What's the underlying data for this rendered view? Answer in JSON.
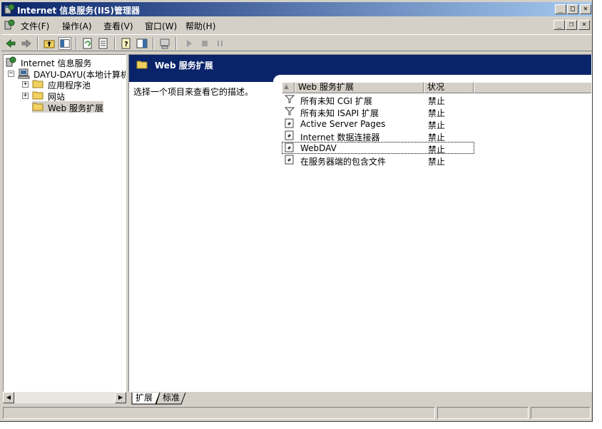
{
  "window": {
    "title": "Internet 信息服务(IIS)管理器",
    "minimize": "_",
    "maximize": "□",
    "close": "×"
  },
  "menubar": {
    "items": [
      {
        "label": "文件(F)"
      },
      {
        "label": "操作(A)"
      },
      {
        "label": "查看(V)"
      },
      {
        "label": "窗口(W)"
      },
      {
        "label": "帮助(H)"
      }
    ],
    "mdi_minimize": "_",
    "mdi_restore": "❐",
    "mdi_close": "×"
  },
  "tree": {
    "root": "Internet 信息服务",
    "computer": "DAYU-DAYU(本地计算机)",
    "expand_collapsed": "+",
    "expand_open": "−",
    "children": [
      {
        "label": "应用程序池"
      },
      {
        "label": "网站"
      },
      {
        "label": "Web 服务扩展"
      }
    ]
  },
  "right": {
    "header_title": "Web 服务扩展",
    "description": "选择一个项目来查看它的描述。",
    "columns": {
      "name": "Web 服务扩展",
      "status": "状况"
    },
    "rows": [
      {
        "name": "所有未知 CGI 扩展",
        "status": "禁止",
        "icon": "filter-icon"
      },
      {
        "name": "所有未知 ISAPI 扩展",
        "status": "禁止",
        "icon": "filter-icon"
      },
      {
        "name": "Active Server Pages",
        "status": "禁止",
        "icon": "extension-icon"
      },
      {
        "name": "Internet 数据连接器",
        "status": "禁止",
        "icon": "extension-icon"
      },
      {
        "name": "WebDAV",
        "status": "禁止",
        "icon": "extension-icon"
      },
      {
        "name": "在服务器端的包含文件",
        "status": "禁止",
        "icon": "extension-icon"
      }
    ]
  },
  "tabs": [
    {
      "label": "扩展"
    },
    {
      "label": "标准"
    }
  ],
  "colors": {
    "title_start": "#0a246a",
    "title_end": "#a6caf0",
    "face": "#d4d0c8",
    "header_bg": "#0a246a"
  }
}
